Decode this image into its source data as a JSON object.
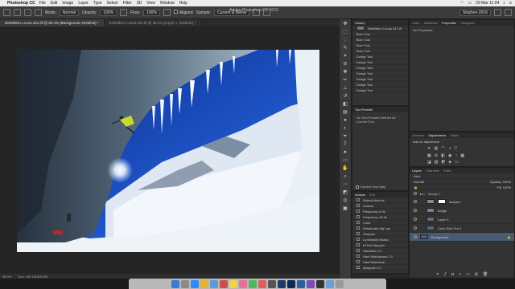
{
  "menubar": {
    "app": "Photoshop CC",
    "items": [
      "File",
      "Edit",
      "Image",
      "Layer",
      "Type",
      "Select",
      "Filter",
      "3D",
      "View",
      "Window",
      "Help"
    ],
    "clock": "29 Mar  11:04"
  },
  "options": {
    "mode_label": "Mode:",
    "mode_value": "Normal",
    "opacity_label": "Opacity:",
    "opacity_value": "100%",
    "flow_label": "Flow:",
    "flow_value": "100%",
    "aligned_label": "Aligned",
    "sample_label": "Sample:",
    "sample_value": "Current & Below",
    "workspace": "Stephen 2016"
  },
  "window_title": "Adobe Photoshop CC 2015",
  "tabs": [
    "Eisfeldern Lonca 241.tif @ 36.4% (Background, RGB/16) *",
    "Eisfeldern Lonca 241.tif @ 36.2% (Layer 1, RGB/16) *"
  ],
  "status": {
    "zoom": "36.4%",
    "doc": "Doc: 130.1M/480.3M"
  },
  "history": {
    "tab": "History",
    "snapshot": "Eisfeldern Lonca 241.tif",
    "items": [
      "Burn Tool",
      "Burn Tool",
      "Burn Tool",
      "Burn Tool",
      "Dodge Tool",
      "Dodge Tool",
      "Dodge Tool",
      "Dodge Tool",
      "Dodge Tool",
      "Dodge Tool",
      "Dodge Tool"
    ]
  },
  "tool_presets": {
    "tab": "Tool Presets",
    "message": "No Tool Presets Defined for Current Tool.",
    "current_only": "Current Tool Only"
  },
  "actions": {
    "tabs": [
      "Actions",
      "Info"
    ],
    "items": [
      "Default Actions",
      "Actions",
      "Frequency 6 bit",
      "Frequency 16 bit",
      "Color",
      "Desaturate Adj Lay",
      "Sharpen",
      "Luminosity Masks",
      "Hi Def Sharpen",
      "Gaussian 1.0",
      "Haut Wachposso 1.0",
      "Haut Wachsnie...",
      "Aprigose 0.9"
    ]
  },
  "properties": {
    "tabs": [
      "Color",
      "Swatches",
      "Properties",
      "Histogram"
    ],
    "message": "No Properties"
  },
  "adjustments": {
    "tabs": [
      "Libraries",
      "Adjustments",
      "Styles"
    ],
    "add_label": "Add an adjustment"
  },
  "layers": {
    "tabs": [
      "Layers",
      "Channels",
      "Paths"
    ],
    "kind": "Kind",
    "blend": "Normal",
    "opacity": "Opacity: 100%",
    "fill": "Fill: 100%",
    "items": [
      "Group 1",
      "sharpen",
      "dodge",
      "Layer 3",
      "Color Efex Pro 4",
      "Background"
    ]
  }
}
